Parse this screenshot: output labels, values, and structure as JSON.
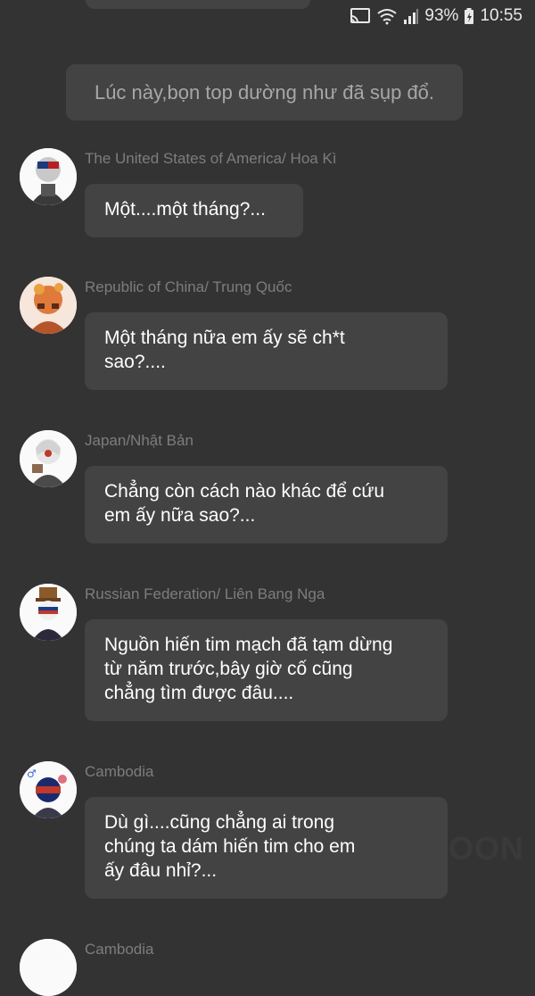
{
  "status_bar": {
    "battery_percent": "93%",
    "time": "10:55",
    "icons": [
      "cast-icon",
      "wifi-icon",
      "signal-icon",
      "battery-charging-icon"
    ]
  },
  "narration": "Lúc này,bọn top dường như đã sụp đổ.",
  "messages": [
    {
      "sender": "The United States of America/ Hoa Kì",
      "text": "Một....một tháng?..."
    },
    {
      "sender": "Republic of China/ Trung Quốc",
      "text": "Một tháng nữa em ấy sẽ ch*t\nsao?...."
    },
    {
      "sender": "Japan/Nhật Bản",
      "text": "Chẳng còn cách nào khác để cứu\nem ấy nữa sao?..."
    },
    {
      "sender": "Russian Federation/ Liên Bang Nga",
      "text": "Nguồn hiến tim mạch đã tạm dừng\ntừ năm trước,bây giờ cố cũng\nchẳng tìm được đâu...."
    },
    {
      "sender": "Cambodia",
      "text": "Dù gì....cũng chẳng ai trong\nchúng ta dám hiến tim cho em\nấy đâu nhỉ?..."
    },
    {
      "sender": "Cambodia",
      "text": ""
    }
  ],
  "watermark": "OON",
  "colors": {
    "background": "#333333",
    "bubble": "#434343",
    "sender": "#7d7d7d",
    "narration_text": "#a7a7a7"
  }
}
